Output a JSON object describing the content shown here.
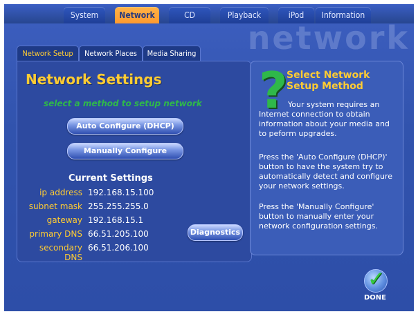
{
  "tabs": [
    {
      "label": "System",
      "active": false
    },
    {
      "label": "Network",
      "active": true
    },
    {
      "label": "CD",
      "active": false
    },
    {
      "label": "Playback",
      "active": false
    },
    {
      "label": "iPod",
      "active": false
    },
    {
      "label": "Information",
      "active": false
    }
  ],
  "section_word": "network",
  "subtabs": [
    {
      "label": "Network Setup",
      "active": true
    },
    {
      "label": "Network Places",
      "active": false
    },
    {
      "label": "Media Sharing",
      "active": false
    }
  ],
  "panel": {
    "title": "Network Settings",
    "hint": "select a method to setup network",
    "auto_button": "Auto Configure (DHCP)",
    "manual_button": "Manually Configure",
    "current_heading": "Current Settings",
    "settings": [
      {
        "label": "ip address",
        "value": "192.168.15.100"
      },
      {
        "label": "subnet mask",
        "value": "255.255.255.0"
      },
      {
        "label": "gateway",
        "value": "192.168.15.1"
      },
      {
        "label": "primary DNS",
        "value": "66.51.205.100"
      },
      {
        "label": "secondary DNS",
        "value": "66.51.206.100"
      }
    ],
    "diagnostics_button": "Diagnostics"
  },
  "help": {
    "title": "Select Network Setup Method",
    "para1": "Your system requires an Internet connection to obtain information about your media and to peform upgrades.",
    "para2": "Press the 'Auto Configure (DHCP)' button to have the system try to automatically detect and configure your network settings.",
    "para3": "Press the 'Manually Configure' button to manually enter your network configuration settings."
  },
  "done_label": "DONE",
  "colors": {
    "background": "#3153ad",
    "accent_orange": "#ff9a2e",
    "label_yellow": "#ffcc33",
    "hint_green": "#2fb84a"
  },
  "icons": {
    "help": "question-mark-icon",
    "done": "checkmark-icon"
  }
}
